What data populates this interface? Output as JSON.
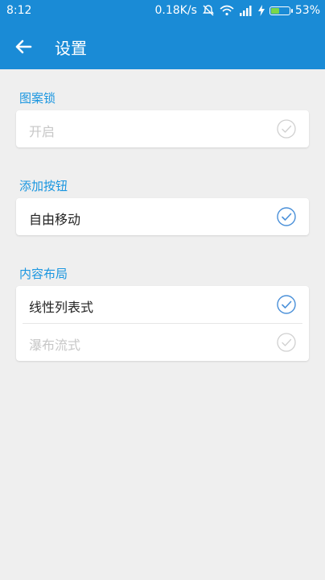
{
  "status": {
    "time": "8:12",
    "speed": "0.18K/s",
    "battery": "53%",
    "battery_level": 0.53,
    "icons": [
      "mute-icon",
      "wifi-icon",
      "signal-icon",
      "charging-icon",
      "battery-icon"
    ]
  },
  "appbar": {
    "title": "设置",
    "back_icon": "arrow-left-icon"
  },
  "sections": [
    {
      "title": "图案锁",
      "options": [
        {
          "label": "开启",
          "selected": false
        }
      ]
    },
    {
      "title": "添加按钮",
      "options": [
        {
          "label": "自由移动",
          "selected": true
        }
      ]
    },
    {
      "title": "内容布局",
      "options": [
        {
          "label": "线性列表式",
          "selected": true
        },
        {
          "label": "瀑布流式",
          "selected": false
        }
      ]
    }
  ],
  "colors": {
    "primary": "#1a8bd6",
    "section_title": "#1a96e0",
    "check_active": "#4a90d9",
    "check_inactive": "#d0d0d0",
    "background": "#efefef"
  }
}
